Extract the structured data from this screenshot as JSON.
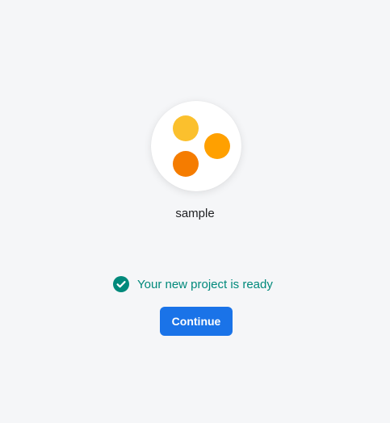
{
  "project": {
    "name": "sample",
    "logo_colors": [
      "#fbc02d",
      "#ffa000",
      "#f57c00"
    ]
  },
  "status": {
    "message": "Your new project is ready",
    "icon": "check-circle-icon",
    "color": "#00897b"
  },
  "actions": {
    "continue_label": "Continue",
    "accent_color": "#1a73e8"
  }
}
